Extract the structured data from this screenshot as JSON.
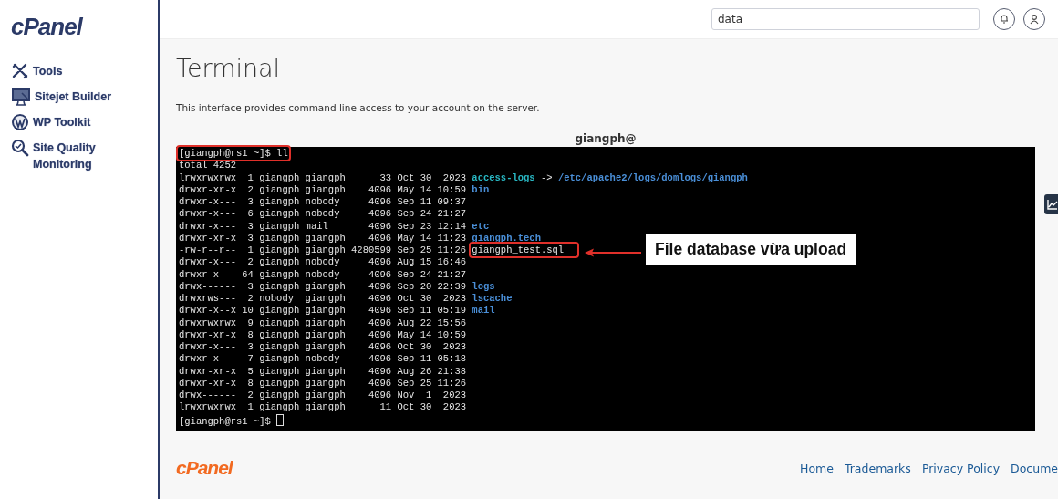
{
  "sidebar": {
    "logo": "cPanel",
    "items": [
      {
        "label": "Tools",
        "kind": "tools"
      },
      {
        "label": "Sitejet Builder",
        "kind": "builder"
      },
      {
        "label": "WP Toolkit",
        "kind": "wordpress"
      },
      {
        "label": "Site Quality Monitoring",
        "kind": "quality"
      }
    ]
  },
  "header": {
    "search": {
      "value": "data"
    }
  },
  "page": {
    "title": "Terminal",
    "description": "This interface provides command line access to your account on the server."
  },
  "terminal": {
    "title": "giangph@",
    "prompt": {
      "text": "[giangph@rs1 ~]$ ll",
      "highlighted": true
    },
    "lines": [
      {
        "text": "total 4252"
      },
      {
        "text": "lrwxrwxrwx  1 giangph giangph      33 Oct 30  2023 ",
        "name": "access-logs",
        "kind": "link",
        "arrow": " -> ",
        "target": "/etc/apache2/logs/domlogs/giangph"
      },
      {
        "text": "drwxr-xr-x  2 giangph giangph    4096 May 14 10:59 ",
        "name": "bin",
        "kind": "dir"
      },
      {
        "text": "drwxr-x---  3 giangph nobody     4096 Sep 11 09:37"
      },
      {
        "text": "drwxr-x---  6 giangph nobody     4096 Sep 24 21:27"
      },
      {
        "text": "drwxr-x---  3 giangph mail       4096 Sep 23 12:14 ",
        "name": "etc",
        "kind": "dir"
      },
      {
        "text": "drwxr-xr-x  3 giangph giangph    4096 May 14 11:23 ",
        "name": "giangph.tech",
        "kind": "dir"
      },
      {
        "text": "-rw-r--r--  1 giangph giangph 4280599 Sep 25 11:26 ",
        "name": "giangph_test.sql",
        "kind": "file",
        "highlighted": true
      },
      {
        "text": "drwxr-x---  2 giangph nobody     4096 Aug 15 16:46"
      },
      {
        "text": "drwxr-x--- 64 giangph nobody     4096 Sep 24 21:27"
      },
      {
        "text": "drwx------  3 giangph giangph    4096 Sep 20 22:39 ",
        "name": "logs",
        "kind": "dir"
      },
      {
        "text": "drwxrws---  2 nobody  giangph    4096 Oct 30  2023 ",
        "name": "lscache",
        "kind": "dir"
      },
      {
        "text": "drwxr-x--x 10 giangph giangph    4096 Sep 11 05:19 ",
        "name": "mail",
        "kind": "dir"
      },
      {
        "text": "drwxrwxrwx  9 giangph giangph    4096 Aug 22 15:56"
      },
      {
        "text": "drwxr-xr-x  8 giangph giangph    4096 May 14 10:59"
      },
      {
        "text": "drwxr-x---  3 giangph giangph    4096 Oct 30  2023"
      },
      {
        "text": "drwxr-x---  7 giangph nobody     4096 Sep 11 05:18"
      },
      {
        "text": "drwxr-xr-x  5 giangph giangph    4096 Aug 26 21:38"
      },
      {
        "text": "drwxr-xr-x  8 giangph giangph    4096 Sep 25 11:26"
      },
      {
        "text": "drwx------  2 giangph giangph    4096 Nov  1  2023"
      },
      {
        "text": "lrwxrwxrwx  1 giangph giangph      11 Oct 30  2023"
      }
    ],
    "last_prompt": "[giangph@rs1 ~]$ ",
    "callout": "File database vừa upload"
  },
  "footer": {
    "logo": "cPanel",
    "links": [
      "Home",
      "Trademarks",
      "Privacy Policy",
      "Docume"
    ]
  }
}
